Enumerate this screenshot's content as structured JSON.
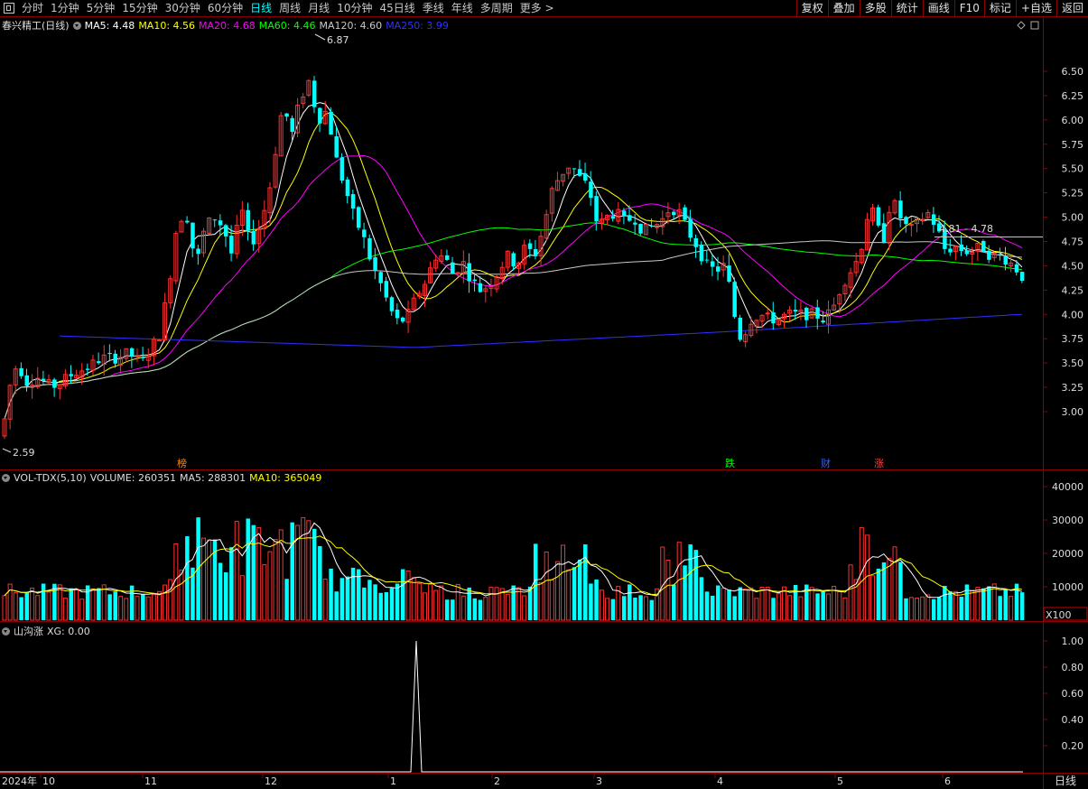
{
  "toolbar": {
    "periods": [
      "分时",
      "1分钟",
      "5分钟",
      "15分钟",
      "30分钟",
      "60分钟",
      "日线",
      "周线",
      "月线",
      "10分钟",
      "45日线",
      "季线",
      "年线",
      "多周期",
      "更多 >"
    ],
    "active_period": "日线",
    "right_buttons": [
      "复权",
      "叠加",
      "多股",
      "统计",
      "画线",
      "F10",
      "标记",
      "+自选",
      "返回"
    ]
  },
  "main_chart": {
    "title": "春兴精工(日线)",
    "ma": [
      {
        "label": "MA5: 4.48",
        "color": "#ffffff"
      },
      {
        "label": "MA10: 4.56",
        "color": "#ffff00"
      },
      {
        "label": "MA20: 4.68",
        "color": "#ff00ff"
      },
      {
        "label": "MA60: 4.46",
        "color": "#00ff00"
      },
      {
        "label": "MA120: 4.60",
        "color": "#c8c8c8"
      },
      {
        "label": "MA250: 3.99",
        "color": "#3030ff"
      }
    ],
    "y_ticks": [
      "6.50",
      "6.25",
      "6.00",
      "5.75",
      "5.50",
      "5.25",
      "5.00",
      "4.75",
      "4.50",
      "4.25",
      "4.00",
      "3.75",
      "3.50",
      "3.25",
      "3.00"
    ],
    "high_label": "6.87",
    "low_label": "2.59",
    "range_label": "4.81 - 4.78",
    "markers": [
      {
        "text": "榜",
        "color": "#ff8c00"
      },
      {
        "text": "跌",
        "color": "#00ff00"
      },
      {
        "text": "财",
        "color": "#3060ff"
      },
      {
        "text": "涨",
        "color": "#ff4040"
      }
    ]
  },
  "volume_chart": {
    "title": "VOL-TDX(5,10)",
    "volume": "VOLUME: 260351",
    "ma5": "MA5: 288301",
    "ma10": "MA10: 365049",
    "y_ticks": [
      "40000",
      "30000",
      "20000",
      "10000"
    ],
    "unit": "X100"
  },
  "indicator_chart": {
    "title": "山沟涨",
    "xg": "XG: 0.00",
    "y_ticks": [
      "1.00",
      "0.80",
      "0.60",
      "0.40",
      "0.20"
    ]
  },
  "x_axis": {
    "labels": [
      "2024年",
      "10",
      "11",
      "12",
      "1",
      "2",
      "3",
      "4",
      "5",
      "6"
    ],
    "period_button": "日线"
  },
  "colors": {
    "up": "#ff3030",
    "down": "#00ffff",
    "grid": "#8b0000"
  }
}
